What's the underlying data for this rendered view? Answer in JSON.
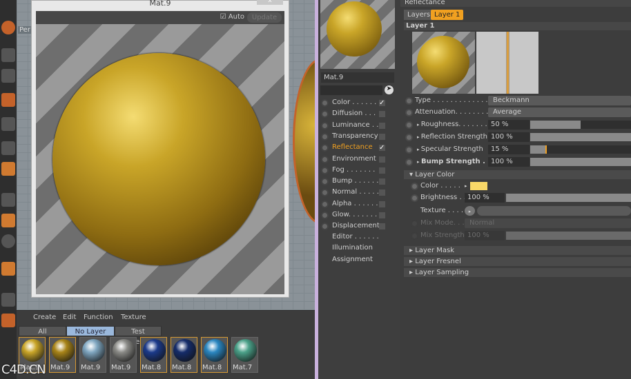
{
  "preview_window": {
    "title": "Mat.9",
    "auto_label": "Auto",
    "update_label": "Update",
    "close_label": "x"
  },
  "viewport": {
    "camera_label": "Per"
  },
  "material_manager": {
    "menu": [
      "Create",
      "Edit",
      "Function",
      "Texture"
    ],
    "tabs": [
      "All",
      "No Layer",
      "Test materials"
    ],
    "materials": [
      {
        "name": "Mat.9",
        "color": "#c9a528",
        "selected": true
      },
      {
        "name": "Mat.9",
        "color": "#a88418",
        "selected": true
      },
      {
        "name": "Mat.9",
        "color": "#7fa6c0",
        "selected": false
      },
      {
        "name": "Mat.9",
        "color": "#8a8a86",
        "selected": false
      },
      {
        "name": "Mat.8",
        "color": "#1b3a8a",
        "selected": true
      },
      {
        "name": "Mat.8",
        "color": "#152c6a",
        "selected": true
      },
      {
        "name": "Mat.8",
        "color": "#2a86c0",
        "selected": true
      },
      {
        "name": "Mat.7",
        "color": "#4aa088",
        "selected": false
      }
    ]
  },
  "material_panel": {
    "name": "Mat.9",
    "channels": [
      {
        "label": "Color . . . . . .",
        "checked": true
      },
      {
        "label": "Diffusion . . .",
        "checked": false
      },
      {
        "label": "Luminance . .",
        "checked": false
      },
      {
        "label": "Transparency",
        "checked": false
      },
      {
        "label": "Reflectance",
        "checked": true,
        "active": true
      },
      {
        "label": "Environment",
        "checked": false
      },
      {
        "label": "Fog . . . . . . .",
        "checked": false
      },
      {
        "label": "Bump . . . . . .",
        "checked": false
      },
      {
        "label": "Normal . . . . .",
        "checked": false
      },
      {
        "label": "Alpha . . . . . .",
        "checked": false
      },
      {
        "label": "Glow. . . . . . .",
        "checked": false
      },
      {
        "label": "Displacement",
        "checked": false
      }
    ],
    "extras": [
      "Editor . . . . . .",
      "Illumination",
      "Assignment"
    ]
  },
  "attributes": {
    "header": "Reflectance",
    "tabs": [
      "Layers",
      "Layer 1"
    ],
    "layer_title": "Layer 1",
    "type_label": "Type . . . . . . . . . . . . . .",
    "type_value": "Beckmann",
    "attenuation_label": "Attenuation. . . . . . . . .",
    "attenuation_value": "Average",
    "sliders": [
      {
        "label": "Roughness. . . . . . . .",
        "value": "50 %",
        "fraction": 0.5
      },
      {
        "label": "Reflection Strength",
        "value": "100 %",
        "fraction": 1.0
      },
      {
        "label": "Specular Strength",
        "value": "15 %",
        "fraction": 0.15
      },
      {
        "label": "Bump Strength . . .",
        "value": "100 %",
        "fraction": 1.0
      }
    ],
    "layer_color": {
      "header": "Layer Color",
      "color_label": "Color . . . . .",
      "color_value": "#f8d868",
      "brightness_label": "Brightness . . .",
      "brightness_value": "100 %",
      "texture_label": "Texture . . . . . .",
      "mix_mode_label": "Mix Mode. . . .",
      "mix_mode_value": "Normal",
      "mix_strength_label": "Mix Strength",
      "mix_strength_value": "100 %"
    },
    "sections": [
      "Layer Mask",
      "Layer Fresnel",
      "Layer Sampling"
    ]
  },
  "watermark": "C4D.CN"
}
